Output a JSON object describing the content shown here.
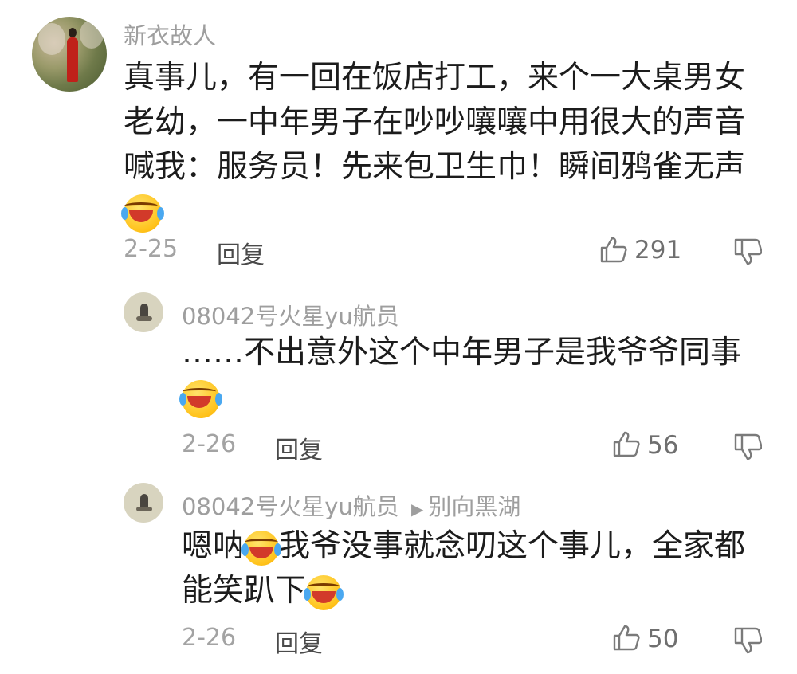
{
  "comments": [
    {
      "username": "新衣故人",
      "text_lines": [
        "真事儿，有一回在饭店打工，来个一大桌男女",
        "老幼，一中年男子在吵吵嚷嚷中用很大的声音",
        "喊我：服务员！先来包卫生巾！瞬间鸦雀无声"
      ],
      "emoji_name": "laugh-cry-emoji",
      "date": "2-25",
      "reply_label": "回复",
      "likes": "291"
    },
    {
      "username": "08042号火星yu航员",
      "text": "……不出意外这个中年男子是我爷爷同事",
      "emoji_name": "laugh-cry-emoji",
      "date": "2-26",
      "reply_label": "回复",
      "likes": "56"
    },
    {
      "username": "08042号火星yu航员",
      "reply_to": "别向黑湖",
      "reply_arrow": "▶",
      "text_part1": "嗯呐",
      "text_part2": "我爷没事就念叨这个事儿，全家都",
      "text_line2": "能笑趴下",
      "emoji_name": "laugh-cry-emoji",
      "date": "2-26",
      "reply_label": "回复",
      "likes": "50"
    }
  ],
  "icons": {
    "like": "thumbs-up-icon",
    "dislike": "thumbs-down-icon"
  }
}
